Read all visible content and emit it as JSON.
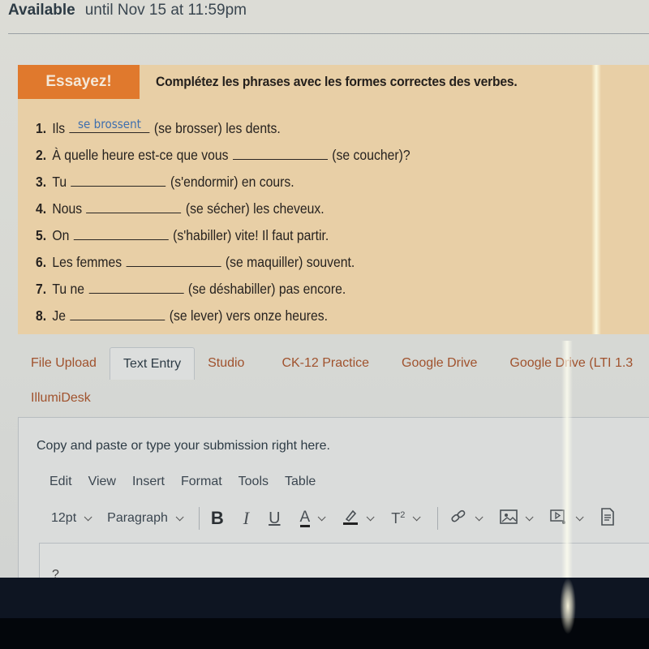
{
  "availability": {
    "label": "Available",
    "value": "until Nov 15 at 11:59pm"
  },
  "exercise": {
    "badge": "Essayez!",
    "instructions": "Complétez les phrases avec les formes correctes des verbes.",
    "items": [
      {
        "num": "1.",
        "before": "Ils",
        "answer": "se brossent",
        "after": "(se brosser) les dents."
      },
      {
        "num": "2.",
        "before": "À quelle heure est-ce que vous",
        "answer": "",
        "after": "(se coucher)?"
      },
      {
        "num": "3.",
        "before": "Tu",
        "answer": "",
        "after": "(s'endormir) en cours."
      },
      {
        "num": "4.",
        "before": "Nous",
        "answer": "",
        "after": "(se sécher) les cheveux."
      },
      {
        "num": "5.",
        "before": "On",
        "answer": "",
        "after": "(s'habiller) vite! Il faut partir."
      },
      {
        "num": "6.",
        "before": "Les femmes",
        "answer": "",
        "after": "(se maquiller) souvent."
      },
      {
        "num": "7.",
        "before": "Tu ne",
        "answer": "",
        "after": "(se déshabiller) pas encore."
      },
      {
        "num": "8.",
        "before": "Je",
        "answer": "",
        "after": "(se lever) vers onze heures."
      }
    ]
  },
  "submission_tabs": [
    {
      "label": "File Upload",
      "active": false
    },
    {
      "label": "Text Entry",
      "active": true
    },
    {
      "label": "Studio",
      "active": false
    },
    {
      "label": "CK-12 Practice",
      "active": false
    },
    {
      "label": "Google Drive",
      "active": false
    },
    {
      "label": "Google Drive (LTI 1.3",
      "active": false
    }
  ],
  "submission_tabs_row2": [
    {
      "label": "IllumiDesk"
    }
  ],
  "panel": {
    "hint": "Copy and paste or type your submission right here.",
    "menu": [
      "Edit",
      "View",
      "Insert",
      "Format",
      "Tools",
      "Table"
    ],
    "toolbar": {
      "font_size": "12pt",
      "block_format": "Paragraph",
      "bold": "B",
      "italic": "I",
      "underline": "U",
      "text_color": "A",
      "superscript": "T",
      "superscript_exp": "2"
    },
    "editor_partial_text": "?"
  },
  "colors": {
    "badge": "#e0792d",
    "exercise_bg": "#e8cfa6",
    "tab_link": "#a0522d",
    "answer_ink": "#3f6fae"
  }
}
